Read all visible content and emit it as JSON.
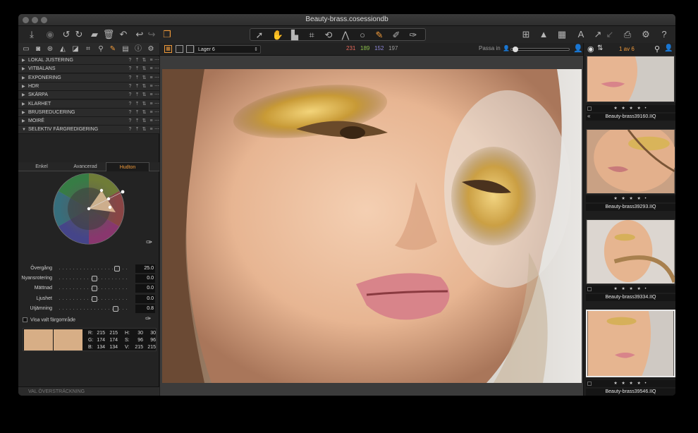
{
  "window": {
    "title": "Beauty-brass.cosessiondb"
  },
  "left_panel": {
    "sections": [
      {
        "label": "LOKAL JUSTERING"
      },
      {
        "label": "VITBALANS"
      },
      {
        "label": "EXPONERING"
      },
      {
        "label": "HDR"
      },
      {
        "label": "SKÄRPA"
      },
      {
        "label": "KLARHET"
      },
      {
        "label": "BRUSREDUCERING"
      },
      {
        "label": "MOIRÉ"
      },
      {
        "label": "SELEKTIV FÄRGREDIGERING"
      }
    ],
    "subtabs": [
      "Enkel",
      "Avancerad",
      "Hudton"
    ],
    "active_subtab": "Hudton",
    "sliders": [
      {
        "label": "Övergång",
        "value": "25.0",
        "position": 0.82
      },
      {
        "label": "Nyansrotering",
        "value": "0.0",
        "position": 0.5
      },
      {
        "label": "Mättnad",
        "value": "0.0",
        "position": 0.5
      },
      {
        "label": "Ljushet",
        "value": "0.0",
        "position": 0.5
      },
      {
        "label": "Utjämning",
        "value": "0.8",
        "position": 0.8
      }
    ],
    "show_selected_label": "Visa valt färgområde",
    "color_readout": {
      "rows": [
        [
          "R:",
          "215",
          "215",
          "H:",
          "30",
          "30"
        ],
        [
          "G:",
          "174",
          "174",
          "S:",
          "96",
          "96"
        ],
        [
          "B:",
          "134",
          "134",
          "V:",
          "215",
          "215"
        ]
      ],
      "swatch_color": "#d7ae86"
    },
    "bottom_section": "VAL ÖVERSTRÄCKNING"
  },
  "viewer_bar": {
    "layer": "Lager 6",
    "r": "231",
    "g": "189",
    "b": "152",
    "l": "197",
    "fit_label": "Passa in"
  },
  "browser": {
    "count_label": "1 av 6",
    "thumbs": [
      {
        "name": "Beauty-brass39160.IIQ"
      },
      {
        "name": "Beauty-brass39293.IIQ"
      },
      {
        "name": "Beauty-brass39334.IIQ"
      },
      {
        "name": "Beauty-brass39546.IIQ"
      }
    ],
    "stars": "★ ★ ★ ★ •"
  },
  "colors": {
    "accent": "#f09a3a",
    "red": "#e7685a",
    "green": "#8cc04b",
    "blue": "#8d86d6",
    "tag_green": "#27c93f"
  }
}
